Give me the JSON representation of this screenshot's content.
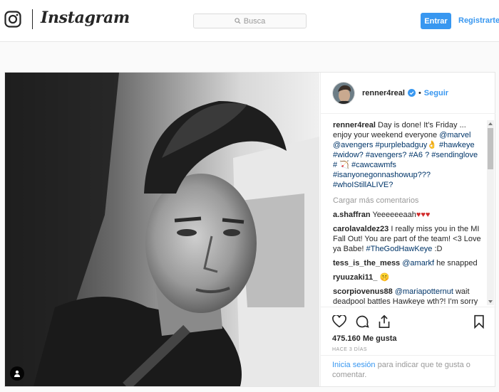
{
  "header": {
    "logo_icon": "instagram-glyph-icon",
    "wordmark": "Instagram",
    "search_placeholder": "Busca",
    "login_label": "Entrar",
    "register_label": "Registrarte"
  },
  "post": {
    "username": "renner4real",
    "verified_icon": "verified-badge-icon",
    "separator": "•",
    "follow_label": "Seguir",
    "caption": {
      "user": "renner4real",
      "text": "Day is done! It's Friday ... enjoy your weekend everyone",
      "mentions": [
        "@marvel",
        "@avengers"
      ],
      "hashtags": [
        "#purplebadguy",
        "#hawkeye",
        "#widow?",
        "#avengers?",
        "#A6 ?",
        "#sendinglove",
        "#",
        "#cawcawmfs",
        "#isanyonegonnashowup???",
        "#whoIStillALIVE?"
      ]
    },
    "load_more": "Cargar más comentarios",
    "comments": [
      {
        "user": "a.shaffran",
        "text": "Yeeeeeeaah",
        "emoji": "♥♥♥"
      },
      {
        "user": "carolavaldez23",
        "text": "I really miss you in the MI Fall Out! You are part of the team! <3 Love ya Babe!",
        "hashtag": "#TheGodHawKeye",
        "tail": ":D"
      },
      {
        "user": "tess_is_the_mess",
        "mention": "@amarkf",
        "text": "he snapped"
      },
      {
        "user": "ryuuzaki11_",
        "emoji": "🤫"
      },
      {
        "user": "scorpiovenus88",
        "mention": "@mariapotternut",
        "text": "wait deadpool battles Hawkeye wth?! I'm sorry but on that one I'm gonna have to root for deadpool"
      }
    ],
    "likes": "475.160 Me gusta",
    "time_ago": "HACE 3 DÍAS",
    "login_prompt": {
      "action": "Inicia sesión",
      "rest": "para indicar que te gusta o comentar."
    }
  }
}
